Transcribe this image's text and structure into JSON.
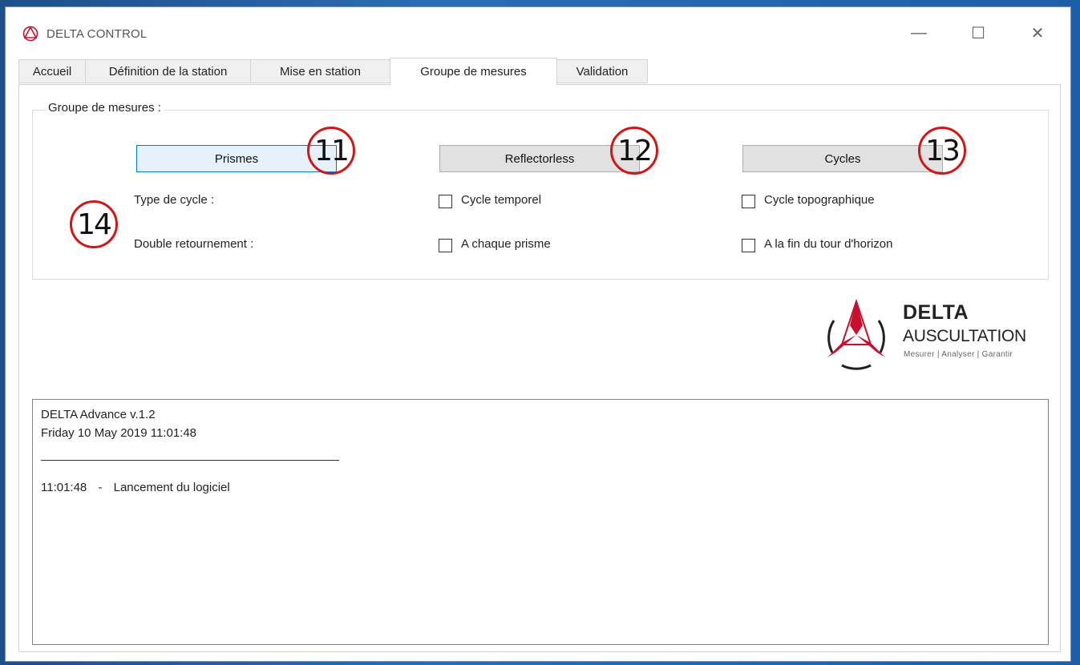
{
  "window": {
    "title": "DELTA CONTROL",
    "minimize_icon": "—",
    "maximize_icon": "☐",
    "close_icon": "✕"
  },
  "tabs": [
    {
      "label": "Accueil"
    },
    {
      "label": "Définition de la station"
    },
    {
      "label": "Mise en station"
    },
    {
      "label": "Groupe de mesures",
      "active": true
    },
    {
      "label": "Validation"
    }
  ],
  "group": {
    "legend": "Groupe de mesures :",
    "buttons": {
      "prismes": "Prismes",
      "reflectorless": "Reflectorless",
      "cycles": "Cycles"
    },
    "type_de_cycle_label": "Type de cycle :",
    "double_retournement_label": "Double retournement :",
    "checkboxes": {
      "cycle_temporel": {
        "label": "Cycle temporel",
        "checked": false
      },
      "cycle_topographique": {
        "label": "Cycle topographique",
        "checked": false
      },
      "a_chaque_prisme": {
        "label": "A chaque prisme",
        "checked": false
      },
      "fin_tour_horizon": {
        "label": "A la fin du tour d'horizon",
        "checked": false
      }
    }
  },
  "callouts": {
    "c11": "11",
    "c12": "12",
    "c13": "13",
    "c14": "14"
  },
  "brand": {
    "name": "DELTA",
    "sub": "AUSCULTATION",
    "tagline": "Mesurer | Analyser | Garantir"
  },
  "log": {
    "line1": "DELTA Advance v.1.2",
    "line2": "Friday 10 May 2019 11:01:48",
    "entry_time": "11:01:48",
    "entry_sep": "-",
    "entry_text": "Lancement du logiciel"
  },
  "colors": {
    "accent": "#0078d7",
    "callout_red": "#d11616",
    "brand_red": "#c8102e"
  }
}
